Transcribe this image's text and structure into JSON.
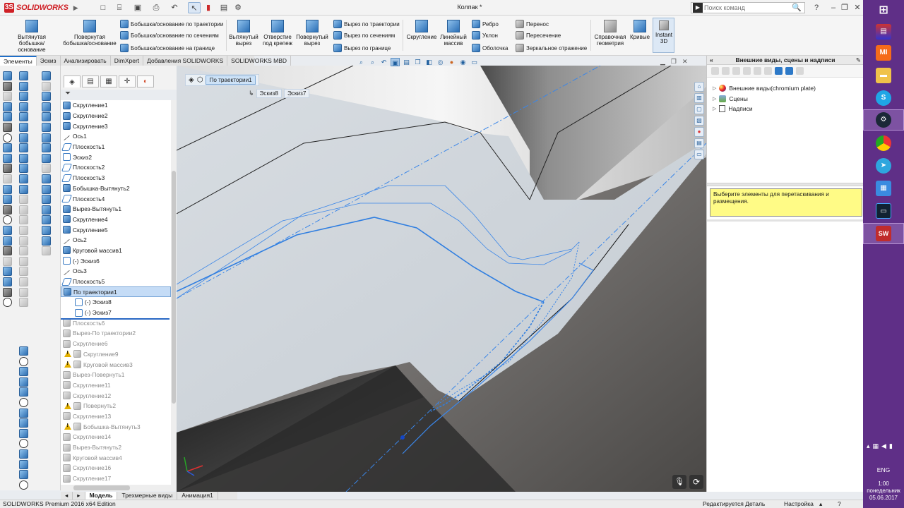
{
  "app": {
    "logo_text": "SOLIDWORKS",
    "doc_title": "Колпак *"
  },
  "search": {
    "placeholder": "Поиск команд",
    "value": ""
  },
  "ribbon": {
    "big": [
      {
        "label1": "Вытянутая",
        "label2": "бобышка/основание"
      },
      {
        "label1": "Повернутая",
        "label2": "бобышка/основание"
      },
      {
        "label1": "Вытянутый",
        "label2": "вырез"
      },
      {
        "label1": "Отверстие",
        "label2": "под крепеж"
      },
      {
        "label1": "Повернутый",
        "label2": "вырез"
      },
      {
        "label1": "Скругление",
        "label2": ""
      },
      {
        "label1": "Линейный",
        "label2": "массив"
      },
      {
        "label1": "Справочная",
        "label2": "геометрия"
      },
      {
        "label1": "Кривые",
        "label2": ""
      },
      {
        "label1": "Instant",
        "label2": "3D"
      }
    ],
    "boss": [
      "Бобышка/основание по траектории",
      "Бобышка/основание по сечениям",
      "Бобышка/основание на границе"
    ],
    "cut": [
      "Вырез по траектории",
      "Вырез по сечениям",
      "Вырез по границе"
    ],
    "mid": [
      "Ребро",
      "Уклон",
      "Оболочка"
    ],
    "right": [
      "Перенос",
      "Пересечение",
      "Зеркальное отражение"
    ]
  },
  "tabs": [
    "Элементы",
    "Эскиз",
    "Анализировать",
    "DimXpert",
    "Добавления SOLIDWORKS",
    "SOLIDWORKS MBD"
  ],
  "tree": [
    {
      "label": "Скругление1",
      "icon": "fillet",
      "state": "normal"
    },
    {
      "label": "Скругление2",
      "icon": "fillet",
      "state": "normal"
    },
    {
      "label": "Скругление3",
      "icon": "fillet",
      "state": "normal"
    },
    {
      "label": "Ось1",
      "icon": "axis",
      "state": "normal"
    },
    {
      "label": "Плоскость1",
      "icon": "plane",
      "state": "normal"
    },
    {
      "label": "Эскиз2",
      "icon": "sketch",
      "state": "normal"
    },
    {
      "label": "Плоскость2",
      "icon": "plane",
      "state": "normal"
    },
    {
      "label": "Плоскость3",
      "icon": "plane",
      "state": "normal"
    },
    {
      "label": "Бобышка-Вытянуть2",
      "icon": "boss",
      "state": "normal"
    },
    {
      "label": "Плоскость4",
      "icon": "plane",
      "state": "normal"
    },
    {
      "label": "Вырез-Вытянуть1",
      "icon": "cut",
      "state": "normal"
    },
    {
      "label": "Скругление4",
      "icon": "fillet",
      "state": "normal"
    },
    {
      "label": "Скругление5",
      "icon": "fillet",
      "state": "normal"
    },
    {
      "label": "Ось2",
      "icon": "axis",
      "state": "normal"
    },
    {
      "label": "Круговой массив1",
      "icon": "pattern",
      "state": "normal"
    },
    {
      "label": "(-) Эскиз6",
      "icon": "sketch",
      "state": "normal"
    },
    {
      "label": "Ось3",
      "icon": "axis",
      "state": "normal"
    },
    {
      "label": "Плоскость5",
      "icon": "plane",
      "state": "normal"
    },
    {
      "label": "По траектории1",
      "icon": "sweep",
      "state": "selected"
    },
    {
      "label": "(-) Эскиз8",
      "icon": "sketch",
      "state": "child"
    },
    {
      "label": "(-) Эскиз7",
      "icon": "sketch",
      "state": "child"
    },
    {
      "label": "Плоскость6",
      "icon": "plane",
      "state": "dim"
    },
    {
      "label": "Вырез-По траектории2",
      "icon": "cut",
      "state": "dim"
    },
    {
      "label": "Скругление6",
      "icon": "fillet",
      "state": "dim"
    },
    {
      "label": "Скругление9",
      "icon": "fillet",
      "state": "dim-warn"
    },
    {
      "label": "Круговой массив3",
      "icon": "pattern",
      "state": "dim-warn"
    },
    {
      "label": "Вырез-Повернуть1",
      "icon": "cut",
      "state": "dim"
    },
    {
      "label": "Скругление11",
      "icon": "fillet",
      "state": "dim"
    },
    {
      "label": "Скругление12",
      "icon": "fillet",
      "state": "dim"
    },
    {
      "label": "Повернуть2",
      "icon": "boss",
      "state": "dim-warn"
    },
    {
      "label": "Скругление13",
      "icon": "fillet",
      "state": "dim"
    },
    {
      "label": "Бобышка-Вытянуть3",
      "icon": "boss",
      "state": "dim-warn"
    },
    {
      "label": "Скругление14",
      "icon": "fillet",
      "state": "dim"
    },
    {
      "label": "Вырез-Вытянуть2",
      "icon": "cut",
      "state": "dim"
    },
    {
      "label": "Круговой массив4",
      "icon": "pattern",
      "state": "dim"
    },
    {
      "label": "Скругление16",
      "icon": "fillet",
      "state": "dim"
    },
    {
      "label": "Скругление17",
      "icon": "fillet",
      "state": "dim"
    }
  ],
  "breadcrumb": {
    "main": "По траектории1",
    "sub": [
      "Эскиз8",
      "Эскиз7"
    ]
  },
  "task_pane": {
    "title": "Внешние виды, сцены и надписи",
    "nodes": [
      "Внешние виды(chromium plate)",
      "Сцены",
      "Надписи"
    ],
    "hint": "Выберите элементы для перетаскивания и размещения."
  },
  "bottom_tabs": [
    "Модель",
    "Трехмерные виды",
    "Анимация1"
  ],
  "status": {
    "left": "SOLIDWORKS Premium 2016 x64 Edition",
    "mode": "Редактируется Деталь",
    "settings": "Настройка"
  },
  "taskbar": {
    "lang": "ENG",
    "time": "1:00",
    "day": "понедельник",
    "date": "05.06.2017"
  },
  "colors": {
    "accent": "#1f6fc9",
    "sketch": "#3a86e8",
    "taskbar": "#5f2f87"
  }
}
